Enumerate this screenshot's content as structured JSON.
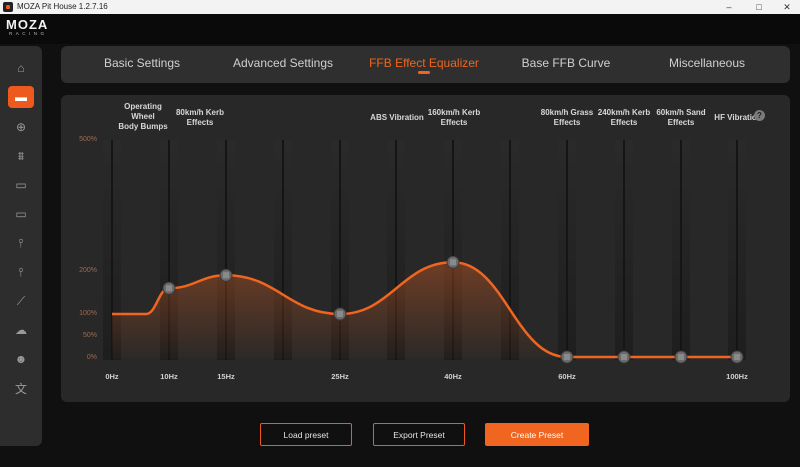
{
  "window": {
    "title": "MOZA Pit House 1.2.7.16",
    "controls": [
      "–",
      "□",
      "✕"
    ]
  },
  "brand": {
    "logo": "MOZA",
    "sub": "RACING"
  },
  "sidebar": {
    "items": [
      {
        "icon": "home-icon",
        "glyph": "⌂"
      },
      {
        "icon": "wheelbase-icon",
        "glyph": "▬",
        "active": true
      },
      {
        "icon": "steering-wheel-icon",
        "glyph": "⊕"
      },
      {
        "icon": "pedals-icon",
        "glyph": "⩩"
      },
      {
        "icon": "dashboard-icon",
        "glyph": "▭"
      },
      {
        "icon": "display-bar-icon",
        "glyph": "▭"
      },
      {
        "icon": "handbrake-icon",
        "glyph": "⫯"
      },
      {
        "icon": "shifter-icon",
        "glyph": "⫯"
      },
      {
        "icon": "sequential-shifter-icon",
        "glyph": "⟋"
      },
      {
        "icon": "cloud-icon",
        "glyph": "☁"
      },
      {
        "icon": "user-icon",
        "glyph": "☻"
      },
      {
        "icon": "translate-icon",
        "glyph": "文"
      }
    ]
  },
  "tabs": [
    {
      "label": "Basic Settings"
    },
    {
      "label": "Advanced Settings"
    },
    {
      "label": "FFB Effect Equalizer",
      "active": true
    },
    {
      "label": "Base FFB Curve"
    },
    {
      "label": "Miscellaneous"
    }
  ],
  "equalizer": {
    "bands": [
      {
        "freq": "0Hz",
        "label": "",
        "value": 100
      },
      {
        "freq": "10Hz",
        "label": "Operating\nWheel\nBody Bumps",
        "value": 160
      },
      {
        "freq": "15Hz",
        "label": "80km/h Kerb\nEffects",
        "value": 190
      },
      {
        "freq": "25Hz",
        "label": "ABS Vibration",
        "value": 100
      },
      {
        "freq": "40Hz",
        "label": "160km/h Kerb\nEffects",
        "value": 220
      },
      {
        "freq": "60Hz",
        "label": "80km/h Grass\nEffects",
        "value": 0
      },
      {
        "freq": "",
        "label": "240km/h Kerb\nEffects",
        "value": 0
      },
      {
        "freq": "",
        "label": "60km/h Sand\nEffects",
        "value": 0
      },
      {
        "freq": "100Hz",
        "label": "HF Vibration",
        "value": 0
      }
    ],
    "y_ticks": [
      "500%",
      "200%",
      "100%",
      "50%",
      "0%"
    ],
    "accent": "#f0651f",
    "help_icon": "?"
  },
  "buttons": {
    "load": "Load preset",
    "export": "Export Preset",
    "create": "Create Preset"
  }
}
